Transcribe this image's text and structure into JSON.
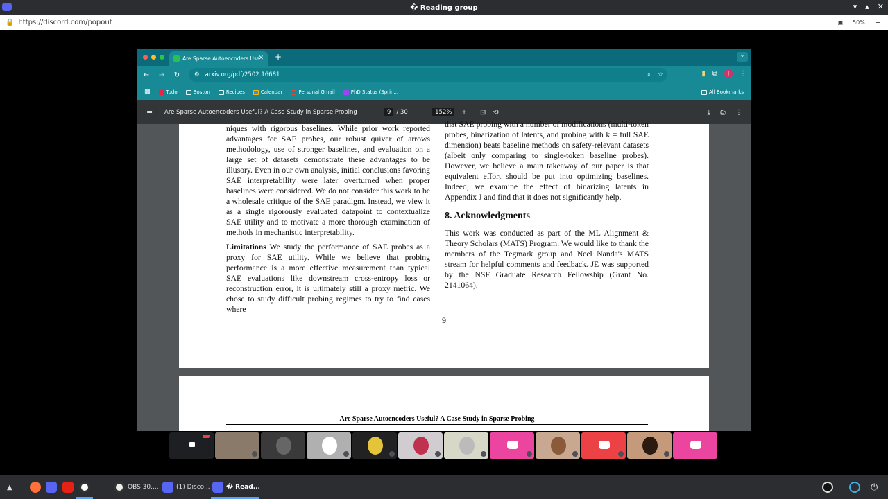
{
  "os": {
    "title": "� Reading group",
    "url": "https://discord.com/popout",
    "zoom": "50%"
  },
  "browser": {
    "tab_title": "Are Sparse Autoencoders Use",
    "address": "arxiv.org/pdf/2502.16681",
    "avatar_letter": "J",
    "bookmarks": [
      "Todo",
      "Boston",
      "Recipes",
      "Calendar",
      "Personal Gmail",
      "PhD Status (Sprin..."
    ],
    "all_bookmarks": "All Bookmarks"
  },
  "pdf": {
    "title": "Are Sparse Autoencoders Useful? A Case Study in Sparse Probing",
    "page_current": "9",
    "page_total": "/ 30",
    "zoom": "152%",
    "col1_p1": "niques with rigorous baselines. While prior work reported advantages for SAE probes, our robust quiver of arrows methodology, use of stronger baselines, and evaluation on a large set of datasets demonstrate these advantages to be illusory. Even in our own analysis, initial conclusions favoring SAE interpretability were later overturned when proper baselines were considered. We do not consider this work to be a wholesale critique of the SAE paradigm. Instead, we view it as a single rigorously evaluated datapoint to contextualize SAE utility and to motivate a more thorough examination of methods in mechanistic interpretability.",
    "col1_p2_bold": "Limitations",
    "col1_p2": " We study the performance of SAE probes as a proxy for SAE utility. While we believe that probing performance is a more effective measurement than typical SAE evaluations like downstream cross-entropy loss or reconstruction error, it is ultimately still a proxy metric. We chose to study difficult probing regimes to try to find cases where",
    "col2_p1": "that SAE probing with a number of modifications (multi-token probes, binarization of latents, and probing with k = full SAE dimension) beats baseline methods on safety-relevant datasets (albeit only comparing to single-token baseline probes). However, we believe a main takeaway of our paper is that equivalent effort should be put into optimizing baselines. Indeed, we examine the effect of binarizing latents in Appendix J and find that it does not significantly help.",
    "heading": "8. Acknowledgments",
    "col2_p2": "This work was conducted as part of the ML Alignment & Theory Scholars (MATS) Program. We would like to thank the members of the Tegmark group and Neel Nanda's MATS stream for helpful comments and feedback. JE was supported by the NSF Graduate Research Fellowship (Grant No. 2141064).",
    "page_number": "9",
    "next_header": "Are Sparse Autoencoders Useful? A Case Study in Sparse Probing"
  },
  "tiles": [
    {
      "bg": "#1e1f22"
    },
    {
      "bg": "#8a7a6a"
    },
    {
      "bg": "#3a3a3a"
    },
    {
      "bg": "#b0b0b0"
    },
    {
      "bg": "#222222"
    },
    {
      "bg": "#d0ccd0"
    },
    {
      "bg": "#d8d8c8"
    },
    {
      "bg": "#eb459f"
    },
    {
      "bg": "#c8a890"
    },
    {
      "bg": "#ed4245"
    },
    {
      "bg": "#c49a7a"
    },
    {
      "bg": "#eb459f"
    }
  ],
  "taskbar": {
    "obs": "OBS 30....",
    "discord1": "(1) Disco...",
    "reading": "� Read..."
  }
}
